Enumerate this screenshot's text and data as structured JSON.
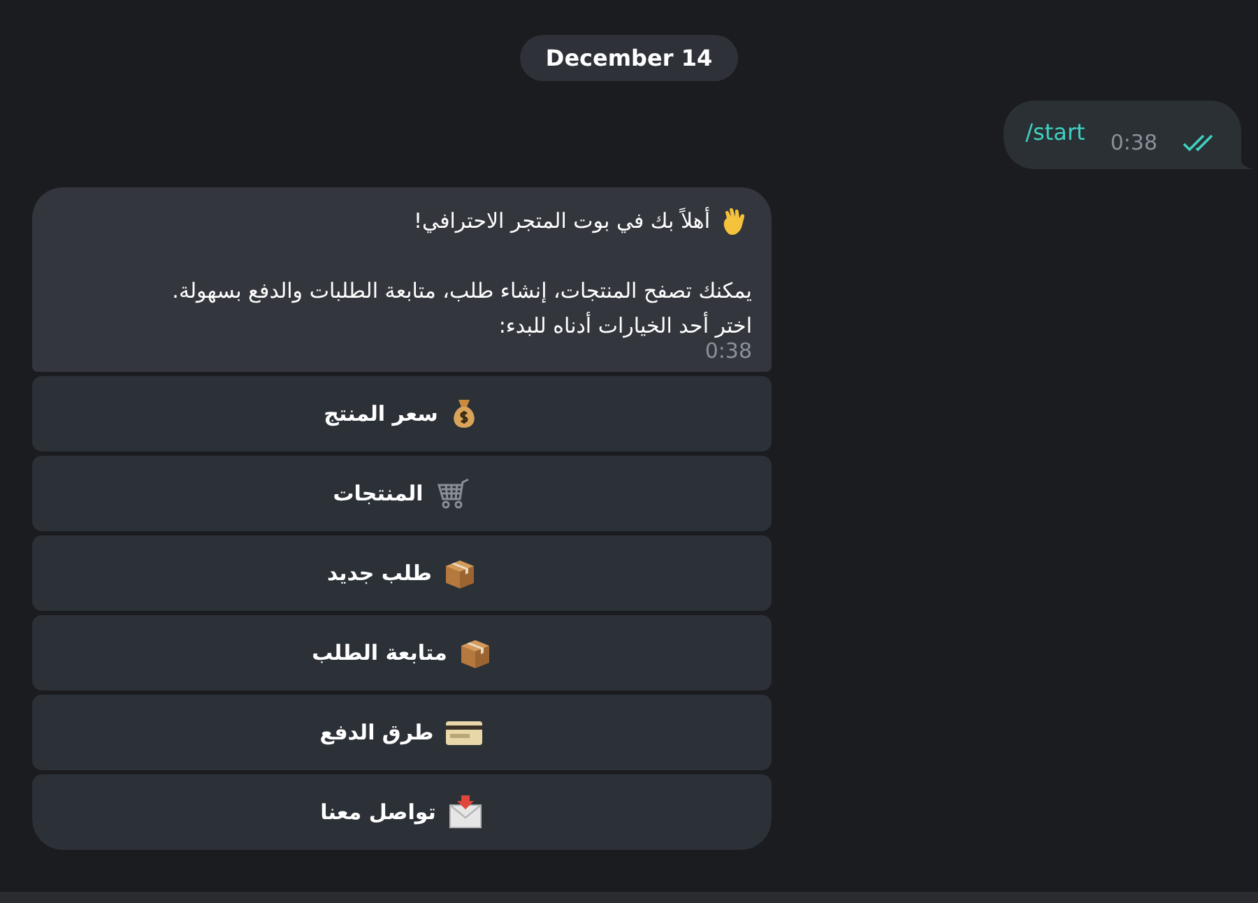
{
  "date_badge": "December 14",
  "outgoing": {
    "text": "/start",
    "time": "0:38",
    "read": true
  },
  "incoming": {
    "lines": [
      "أهلاً بك في بوت المتجر الاحترافي!",
      "يمكنك تصفح المنتجات، إنشاء طلب، متابعة الطلبات والدفع بسهولة.",
      "اختر أحد الخيارات أدناه للبدء:"
    ],
    "time": "0:38"
  },
  "buttons": [
    {
      "label": "سعر المنتج"
    },
    {
      "label": "المنتجات"
    },
    {
      "label": "طلب جديد"
    },
    {
      "label": "متابعة الطلب"
    },
    {
      "label": "طرق الدفع"
    },
    {
      "label": "تواصل معنا"
    }
  ]
}
